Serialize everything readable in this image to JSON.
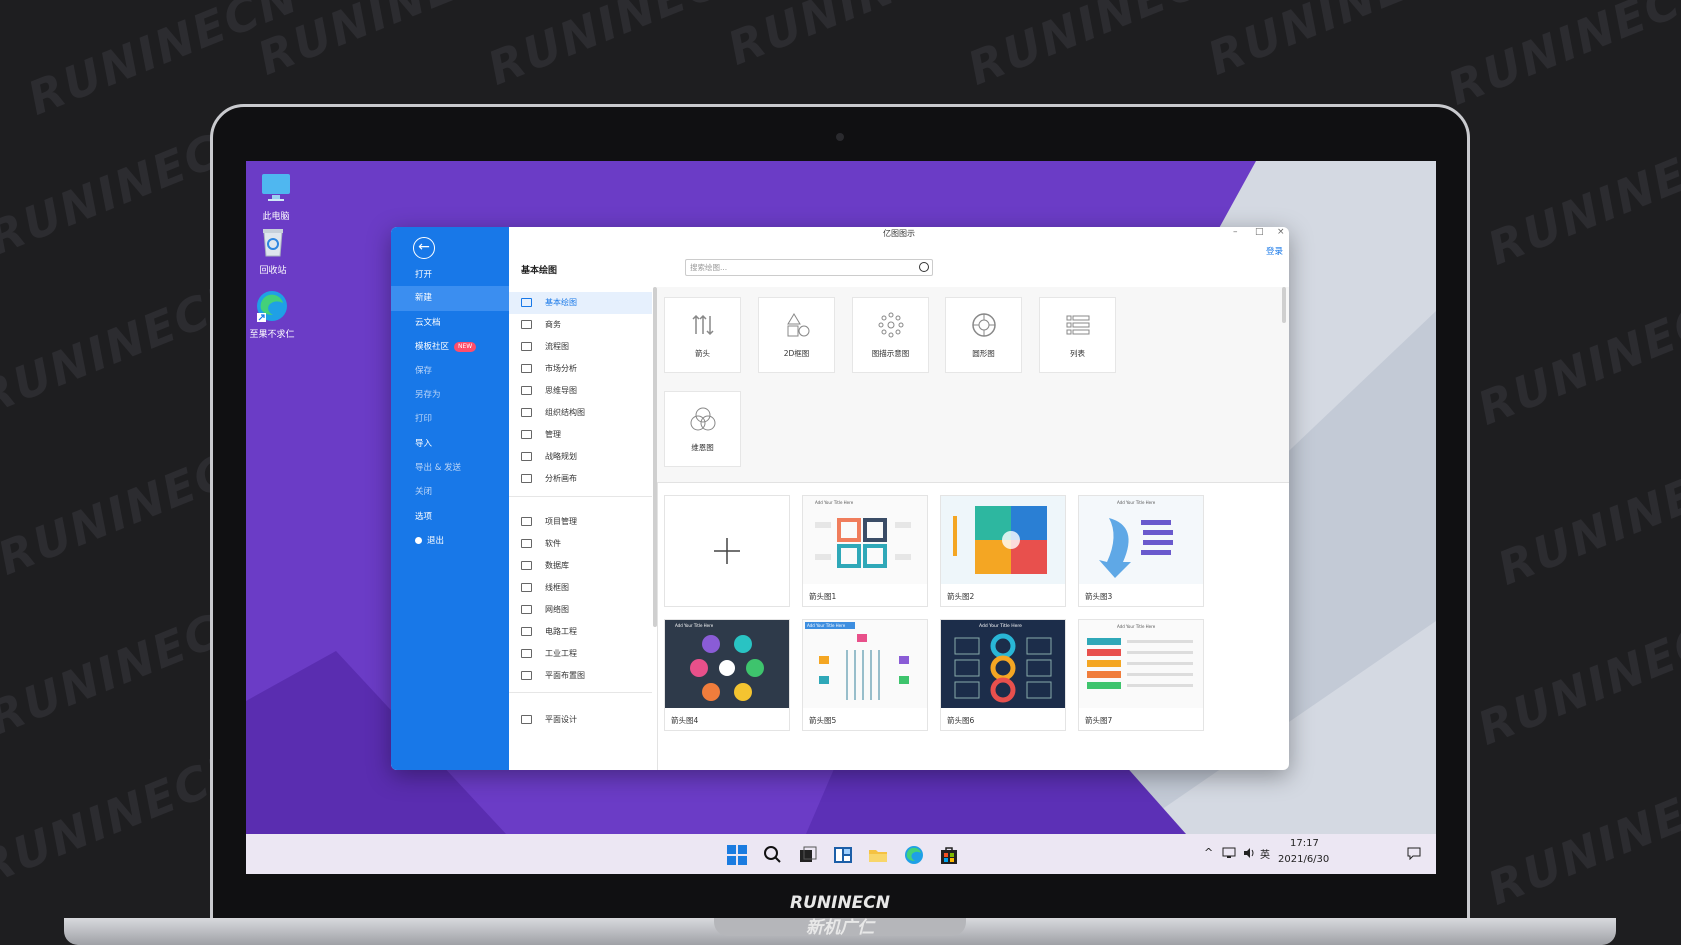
{
  "desktop": {
    "icons": [
      {
        "label": "此电脑",
        "icon": "monitor-icon"
      },
      {
        "label": "回收站",
        "icon": "recycle-bin-icon"
      },
      {
        "label": "至果不求仁",
        "icon": "edge-icon"
      }
    ]
  },
  "laptop": {
    "brand": "RUNINECN 新机广仁"
  },
  "app": {
    "title": "亿图图示",
    "login": "登录",
    "sidebar": {
      "back_icon": "back-arrow-icon",
      "items": [
        {
          "label": "打开"
        },
        {
          "label": "新建",
          "active": true
        },
        {
          "label": "云文档"
        },
        {
          "label": "模板社区",
          "badge": "NEW"
        },
        {
          "label": "保存"
        },
        {
          "label": "另存为"
        },
        {
          "label": "打印"
        },
        {
          "label": "导入"
        },
        {
          "label": "导出 & 发送"
        },
        {
          "label": "关闭"
        },
        {
          "label": "选项"
        },
        {
          "label": "退出"
        }
      ]
    },
    "category_heading": "基本绘图",
    "search": {
      "placeholder": "搜索绘图..."
    },
    "categories": [
      {
        "label": "基本绘图",
        "active": true
      },
      {
        "label": "商务"
      },
      {
        "label": "流程图"
      },
      {
        "label": "市场分析"
      },
      {
        "label": "思维导图"
      },
      {
        "label": "组织结构图"
      },
      {
        "label": "管理"
      },
      {
        "label": "战略规划"
      },
      {
        "label": "分析画布"
      },
      {
        "label": "项目管理"
      },
      {
        "label": "软件"
      },
      {
        "label": "数据库"
      },
      {
        "label": "线框图"
      },
      {
        "label": "网络图"
      },
      {
        "label": "电路工程"
      },
      {
        "label": "工业工程"
      },
      {
        "label": "平面布置图"
      },
      {
        "label": "平面设计"
      }
    ],
    "diagram_types": [
      {
        "label": "箭头",
        "icon": "arrows-icon"
      },
      {
        "label": "2D框图",
        "icon": "shapes-2d-icon"
      },
      {
        "label": "图描示意图",
        "icon": "network-dots-icon"
      },
      {
        "label": "圆形图",
        "icon": "circle-diagram-icon"
      },
      {
        "label": "列表",
        "icon": "list-icon"
      },
      {
        "label": "维恩图",
        "icon": "venn-icon"
      }
    ],
    "templates": [
      {
        "label": "",
        "kind": "new"
      },
      {
        "label": "箭头图1"
      },
      {
        "label": "箭头图2"
      },
      {
        "label": "箭头图3"
      },
      {
        "label": "箭头图4"
      },
      {
        "label": "箭头图5"
      },
      {
        "label": "箭头图6"
      },
      {
        "label": "箭头图7"
      }
    ],
    "template_thumb_texts": {
      "t1": "Add Your Title Here",
      "t3": "Add Your Title Here",
      "t4": "Add Your Title Here",
      "t5": "Add Your Title Here",
      "t6": "Add Your Title Here",
      "t7": "Add Your Title Here"
    }
  },
  "taskbar": {
    "icons": [
      "windows-start-icon",
      "search-icon",
      "task-view-icon",
      "widgets-icon",
      "file-explorer-icon",
      "edge-icon",
      "store-icon"
    ],
    "tray": {
      "lang": "英",
      "time": "17:17",
      "date": "2021/6/30"
    }
  },
  "colors": {
    "accent": "#1878e8",
    "desktop": "#6e3fc7"
  }
}
